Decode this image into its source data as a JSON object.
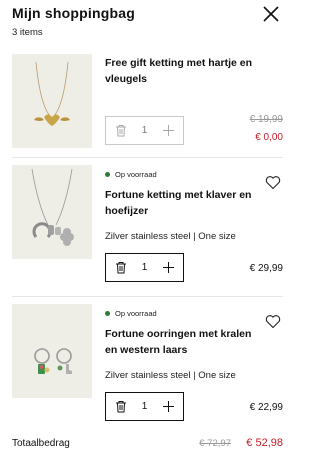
{
  "header": {
    "title": "Mijn shoppingbag",
    "item_count": "3 items",
    "close_icon": "close-icon"
  },
  "items": [
    {
      "name": "Free gift ketting met hartje en vleugels",
      "quantity": "1",
      "old_price": "€ 19,99",
      "price": "€ 0,00",
      "quantity_enabled": false
    },
    {
      "status": "Op voorraad",
      "name": "Fortune ketting met klaver en hoefijzer",
      "variant": "Zilver stainless steel | One size",
      "quantity": "1",
      "price": "€ 29,99",
      "wishlist_icon": "heart-icon"
    },
    {
      "status": "Op voorraad",
      "name": "Fortune oorringen met kralen en western laars",
      "variant": "Zilver stainless steel | One size",
      "quantity": "1",
      "price": "€ 22,99",
      "wishlist_icon": "heart-icon"
    }
  ],
  "total": {
    "label": "Totaalbedrag",
    "old_amount": "€ 72,97",
    "amount": "€ 52,98"
  },
  "colors": {
    "accent_red": "#c0202a",
    "stock_green": "#2f7d32",
    "thumb_bg": "#eeeee7"
  }
}
